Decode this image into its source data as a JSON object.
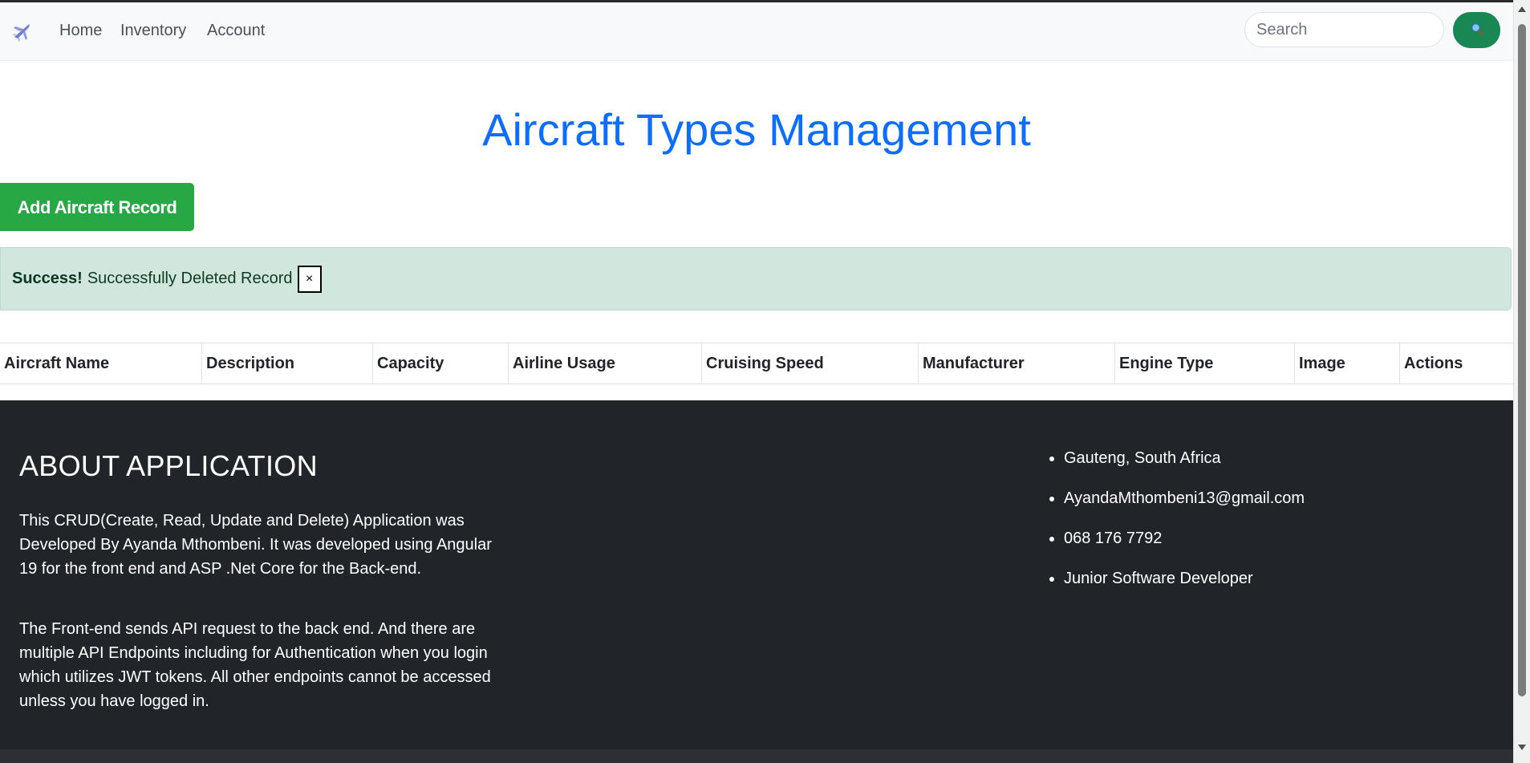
{
  "navbar": {
    "brand_icon": "airplane-icon",
    "links": [
      "Home",
      "Inventory",
      "Account"
    ],
    "search_placeholder": "Search",
    "search_icon": "magnifier-icon",
    "search_button_color": "#198754"
  },
  "main": {
    "title": "Aircraft Types Management",
    "add_button_label": "Add Aircraft Record",
    "alert": {
      "strong": "Success!",
      "message": "Successfully Deleted Record",
      "close": "×"
    },
    "table": {
      "columns": [
        "Aircraft Name",
        "Description",
        "Capacity",
        "Airline Usage",
        "Cruising Speed",
        "Manufacturer",
        "Engine Type",
        "Image",
        "Actions"
      ],
      "rows": []
    }
  },
  "footer": {
    "title": "ABOUT APPLICATION",
    "paragraph1": "This CRUD(Create, Read, Update and Delete) Application was Developed By Ayanda Mthombeni. It was developed using Angular 19 for the front end and ASP .Net Core for the Back-end.",
    "paragraph2": "The Front-end sends API request to the back end. And there are multiple API Endpoints including for Authentication when you login which utilizes JWT tokens. All other endpoints cannot be accessed unless you have logged in.",
    "contacts": [
      "Gauteng, South Africa",
      "AyandaMthombeni13@gmail.com",
      "068 176 7792",
      "Junior Software Developer"
    ]
  },
  "colors": {
    "title_blue": "#0d6efd",
    "add_green": "#28a745",
    "alert_bg": "#d1e7dd",
    "footer_bg": "#212529"
  }
}
